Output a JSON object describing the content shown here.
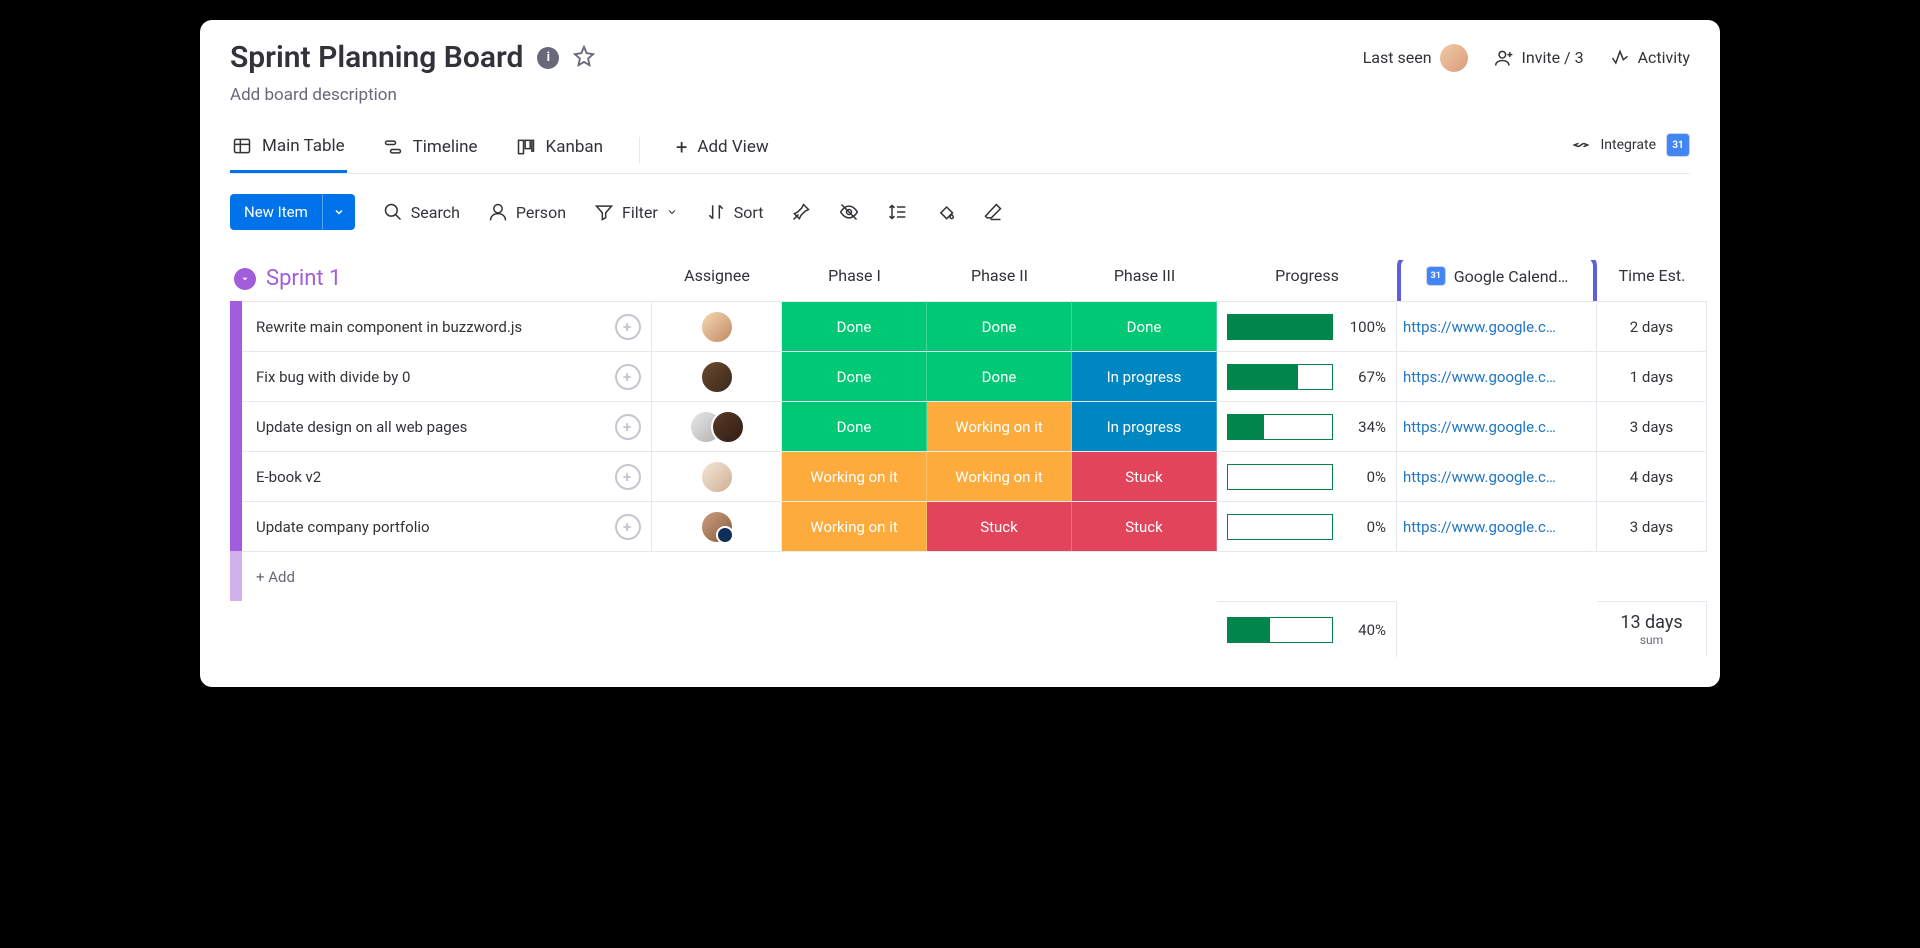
{
  "header": {
    "title": "Sprint Planning Board",
    "description_placeholder": "Add board description",
    "last_seen_label": "Last seen",
    "invite_label": "Invite / 3",
    "activity_label": "Activity"
  },
  "views": {
    "main_table": "Main Table",
    "timeline": "Timeline",
    "kanban": "Kanban",
    "add_view": "Add View",
    "integrate": "Integrate",
    "gcal_badge": "31"
  },
  "toolbar": {
    "new_item": "New Item",
    "search": "Search",
    "person": "Person",
    "filter": "Filter",
    "sort": "Sort"
  },
  "group": {
    "name": "Sprint 1",
    "columns": {
      "assignee": "Assignee",
      "phase1": "Phase I",
      "phase2": "Phase II",
      "phase3": "Phase III",
      "progress": "Progress",
      "gcal": "Google Calend…",
      "time_est": "Time Est."
    },
    "rows": [
      {
        "task": "Rewrite main component in buzzword.js",
        "phase1": "Done",
        "phase2": "Done",
        "phase3": "Done",
        "progress_pct": "100%",
        "progress_fill": 100,
        "link": "https://www.google.c…",
        "time": "2 days"
      },
      {
        "task": "Fix bug with divide by 0",
        "phase1": "Done",
        "phase2": "Done",
        "phase3": "In progress",
        "progress_pct": "67%",
        "progress_fill": 67,
        "link": "https://www.google.c…",
        "time": "1 days"
      },
      {
        "task": "Update design on all web pages",
        "phase1": "Done",
        "phase2": "Working on it",
        "phase3": "In progress",
        "progress_pct": "34%",
        "progress_fill": 34,
        "link": "https://www.google.c…",
        "time": "3 days"
      },
      {
        "task": "E-book v2",
        "phase1": "Working on it",
        "phase2": "Working on it",
        "phase3": "Stuck",
        "progress_pct": "0%",
        "progress_fill": 0,
        "link": "https://www.google.c…",
        "time": "4 days"
      },
      {
        "task": "Update company portfolio",
        "phase1": "Working on it",
        "phase2": "Stuck",
        "phase3": "Stuck",
        "progress_pct": "0%",
        "progress_fill": 0,
        "link": "https://www.google.c…",
        "time": "3 days"
      }
    ],
    "add_label": "+ Add",
    "summary": {
      "progress_pct": "40%",
      "progress_fill": 40,
      "time_total": "13 days",
      "time_sub": "sum"
    }
  },
  "status_class": {
    "Done": "done",
    "Working on it": "working",
    "In progress": "inprog",
    "Stuck": "stuck"
  }
}
